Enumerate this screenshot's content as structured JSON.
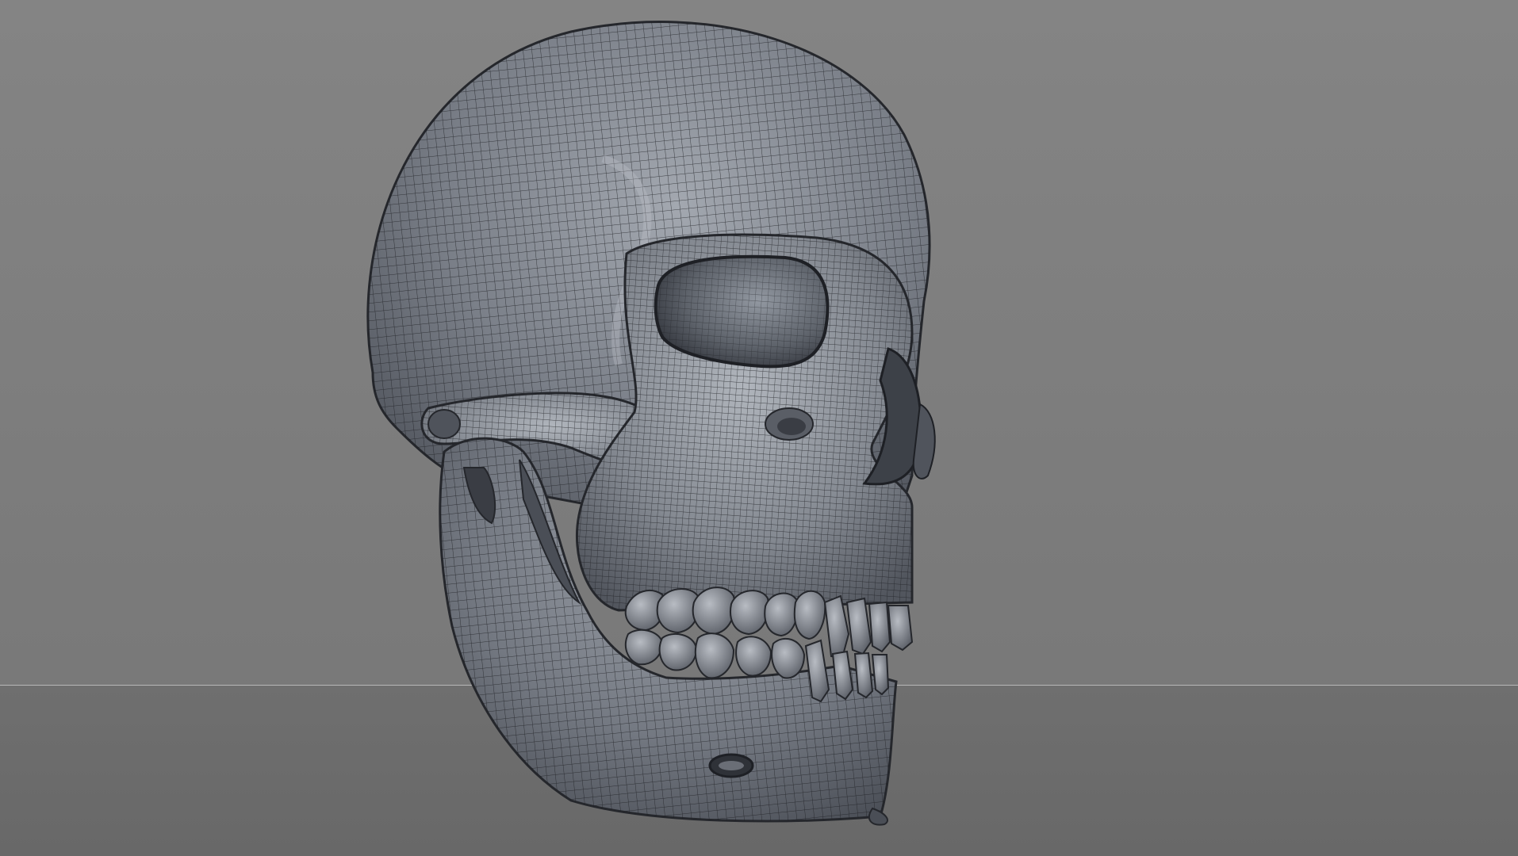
{
  "scene": {
    "subject": "skull-wireframe-mesh",
    "colors": {
      "background_top": "#848484",
      "background_bottom": "#767676",
      "floor": "#6b6b6b",
      "horizon_line": "#b8b8b8",
      "mesh_fill": "#6b7079",
      "mesh_highlight": "#a9aeb6",
      "mesh_shadow": "#3e4249",
      "wire": "#1d1f23"
    }
  }
}
